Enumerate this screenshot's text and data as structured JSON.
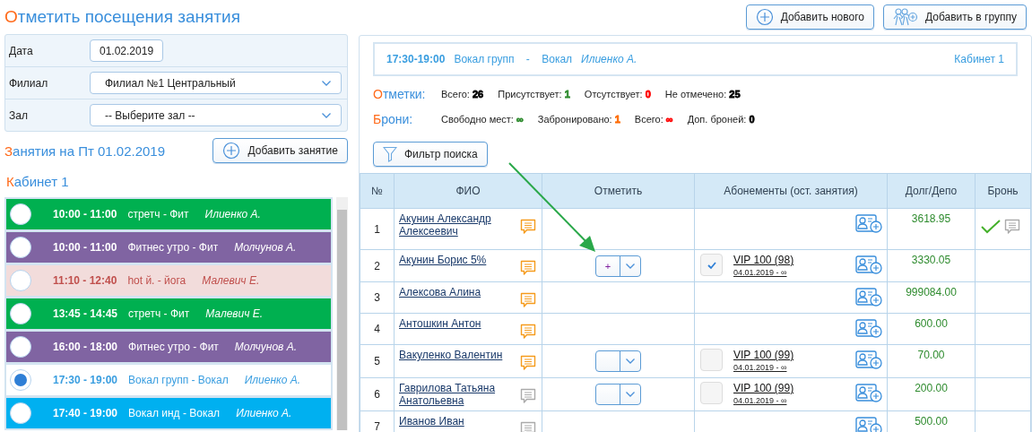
{
  "title": "Отметить посещения занятия",
  "header_buttons": [
    {
      "label": "Добавить нового",
      "kind": "plus"
    },
    {
      "label": "Добавить в группу",
      "kind": "group"
    }
  ],
  "filters": [
    {
      "label": "Дата",
      "kind": "date",
      "value": "01.02.2019"
    },
    {
      "label": "Филиал",
      "kind": "select",
      "value": "Филиал №1 Центральный"
    },
    {
      "label": "Зал",
      "kind": "select",
      "value": "-- Выберите зал --"
    }
  ],
  "lessons_title": "Занятия на Пт 01.02.2019",
  "add_lesson_button": "Добавить занятие",
  "room": "Кабинет 1",
  "lessons": [
    {
      "time": "10:00 - 11:00",
      "name": "стретч - Фит",
      "teacher": "Илиенко А.",
      "color": "#00b050",
      "selected": false
    },
    {
      "time": "10:00 - 11:00",
      "name": "Фитнес утро - Фит",
      "teacher": "Молчунов А.",
      "color": "#8064a2",
      "selected": false
    },
    {
      "time": "11:10 - 12:40",
      "name": "hot й. - йога",
      "teacher": "Малевич Е.",
      "color": "#f2dcdb",
      "selected": false
    },
    {
      "time": "13:45 - 14:45",
      "name": "стретч - Фит",
      "teacher": "Малевич Е.",
      "color": "#00b050",
      "selected": false
    },
    {
      "time": "16:00 - 18:00",
      "name": "Фитнес утро - Фит",
      "teacher": "Молчунов А.",
      "color": "#8064a2",
      "selected": false
    },
    {
      "time": "17:30 - 19:00",
      "name": "Вокал групп - Вокал",
      "teacher": "Илиенко А.",
      "color": "#ffffff",
      "selected": true
    },
    {
      "time": "17:40 - 19:00",
      "name": "Вокал инд - Вокал",
      "teacher": "Илиенко А.",
      "color": "#00b0f0",
      "selected": false
    }
  ],
  "lesson_info": {
    "time": "17:30-19:00",
    "name": "Вокал групп",
    "separator": "-",
    "category": "Вокал",
    "teacher": "Илиенко А.",
    "room": "Кабинет 1"
  },
  "stats": [
    {
      "label": "Отметки:",
      "items": [
        {
          "label": "Всего:",
          "value": "26",
          "color": "#000000"
        },
        {
          "label": "Присутствует:",
          "value": "1",
          "color": "#2e8b2e"
        },
        {
          "label": "Отсутствует:",
          "value": "0",
          "color": "#ff0000"
        },
        {
          "label": "Не отмечено:",
          "value": "25",
          "color": "#000000"
        }
      ]
    },
    {
      "label": "Брони:",
      "items": [
        {
          "label": "Свободно мест:",
          "value": "∞",
          "color": "#2e8b2e"
        },
        {
          "label": "Забронировано:",
          "value": "1",
          "color": "#ff6a00"
        },
        {
          "label": "Всего:",
          "value": "∞",
          "color": "#ff0000"
        },
        {
          "label": "Доп. броней:",
          "value": "0",
          "color": "#000000"
        }
      ]
    }
  ],
  "filter_button": "Фильтр поиска",
  "table": {
    "columns": [
      "№",
      "ФИО",
      "Отметить",
      "Абонементы (ост. занятия)",
      "Долг/Депо",
      "Бронь"
    ],
    "rows": [
      {
        "num": "1",
        "name": "Акунин Александр Алексеевич",
        "has_comment": true,
        "mark_control": false,
        "debt": "3618.95",
        "booked": true
      },
      {
        "num": "2",
        "name": "Акунин Борис 5%",
        "has_comment": true,
        "mark_control": true,
        "mark_label": "+",
        "subscription": {
          "name": "VIP 100 (98)",
          "period": "04.01.2019 - ∞",
          "checked": true
        },
        "debt": "3330.05",
        "booked": false
      },
      {
        "num": "3",
        "name": "Алексова Алина",
        "has_comment": true,
        "mark_control": false,
        "debt": "999084.00",
        "booked": false
      },
      {
        "num": "4",
        "name": "Антошкин Антон",
        "has_comment": true,
        "mark_control": false,
        "debt": "600.00",
        "booked": false
      },
      {
        "num": "5",
        "name": "Вакуленко Валентин",
        "has_comment": true,
        "mark_control": true,
        "subscription": {
          "name": "VIP 100 (99)",
          "period": "04.01.2019 - ∞",
          "checked": false
        },
        "debt": "70.00",
        "booked": false
      },
      {
        "num": "6",
        "name": "Гаврилова Татьяна Анатольевна",
        "has_comment": false,
        "mark_control": true,
        "subscription": {
          "name": "VIP 100 (99)",
          "period": "04.01.2019 - ∞",
          "checked": false
        },
        "debt": "200.00",
        "booked": false
      },
      {
        "num": "7",
        "name": "Иванов Иван",
        "has_comment": false,
        "mark_control": false,
        "debt": "500.00",
        "booked": false
      }
    ]
  }
}
